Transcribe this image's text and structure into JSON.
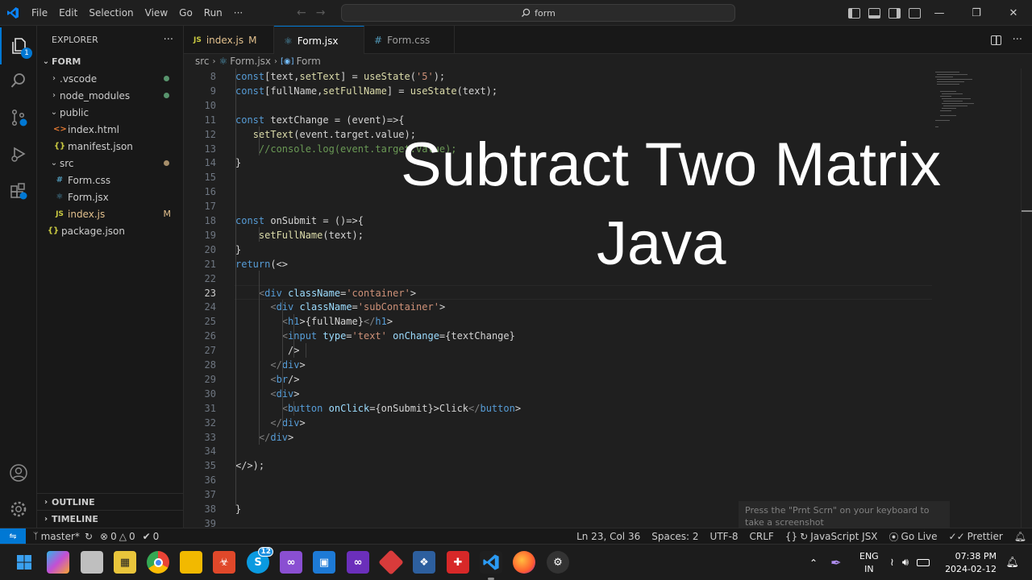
{
  "menubar": {
    "items": [
      "File",
      "Edit",
      "Selection",
      "View",
      "Go",
      "Run"
    ],
    "more": "···",
    "search_text": "form"
  },
  "activity": {
    "explorer_badge": "1"
  },
  "sidebar": {
    "title": "EXPLORER",
    "more": "···",
    "root": "FORM",
    "items": [
      {
        "label": ".vscode",
        "type": "folder",
        "open": false
      },
      {
        "label": "node_modules",
        "type": "folder",
        "open": false
      },
      {
        "label": "public",
        "type": "folder",
        "open": true
      },
      {
        "label": "index.html",
        "type": "html"
      },
      {
        "label": "manifest.json",
        "type": "json"
      },
      {
        "label": "src",
        "type": "folder",
        "open": true
      },
      {
        "label": "Form.css",
        "type": "css"
      },
      {
        "label": "Form.jsx",
        "type": "jsx"
      },
      {
        "label": "index.js",
        "type": "js",
        "badge": "M"
      },
      {
        "label": "package.json",
        "type": "json"
      }
    ],
    "outline": "OUTLINE",
    "timeline": "TIMELINE"
  },
  "tabs": [
    {
      "label": "index.js",
      "icon": "JS",
      "modified": "M"
    },
    {
      "label": "Form.jsx",
      "active": true,
      "unsaved": true
    },
    {
      "label": "Form.css"
    }
  ],
  "breadcrumb": [
    "src",
    "Form.jsx",
    "Form"
  ],
  "editor": {
    "line_numbers": [
      "8",
      "9",
      "10",
      "11",
      "12",
      "13",
      "14",
      "15",
      "16",
      "17",
      "18",
      "19",
      "20",
      "21",
      "22",
      "23",
      "24",
      "25",
      "26",
      "27",
      "28",
      "29",
      "30",
      "31",
      "32",
      "33",
      "34",
      "35",
      "36",
      "37",
      "38",
      "39"
    ],
    "current_line": "23",
    "lines": [
      "    const[text,setText] = useState('5');",
      "    const[fullName,setFullName] = useState(text);",
      "",
      "    const textChange = (event)=>{",
      "       setText(event.target.value);",
      "        //console.log(event.target.value);",
      "    }",
      "",
      "",
      "",
      "    const onSubmit = ()=>{",
      "        setFullName(text);",
      "    }",
      "    return(<>",
      "",
      "        <div className='container'>",
      "          <div className='subContainer'>",
      "            <h1>{fullName}</h1>",
      "            <input type='text' onChange={textChange}",
      "             />",
      "          </div>",
      "          <br/>",
      "          <div>",
      "            <button onClick={onSubmit}>Click</button>",
      "          </div>",
      "        </div>",
      "",
      "    </>);",
      "",
      "",
      "}",
      ""
    ]
  },
  "overlay": {
    "line1": "Subtract Two Matrix",
    "line2": "Java"
  },
  "toast": "Press the \"Prnt Scrn\" on your keyboard to take a screenshot",
  "statusbar": {
    "branch": "master*",
    "errors": "0",
    "warnings": "0",
    "ports": "0",
    "position": "Ln 23, Col 36",
    "spaces": "Spaces: 2",
    "encoding": "UTF-8",
    "eol": "CRLF",
    "language": "JavaScript JSX",
    "golive": "Go Live",
    "prettier": "Prettier"
  },
  "taskbar": {
    "lang1": "ENG",
    "lang2": "IN",
    "time": "07:38 PM",
    "date": "2024-02-12",
    "skype_badge": "12"
  },
  "colors": {
    "accent": "#0078d4",
    "editor_bg": "#1f1f1f",
    "sidebar_bg": "#181818",
    "modified": "#e2c08d",
    "untracked_dot": "#73c991"
  }
}
